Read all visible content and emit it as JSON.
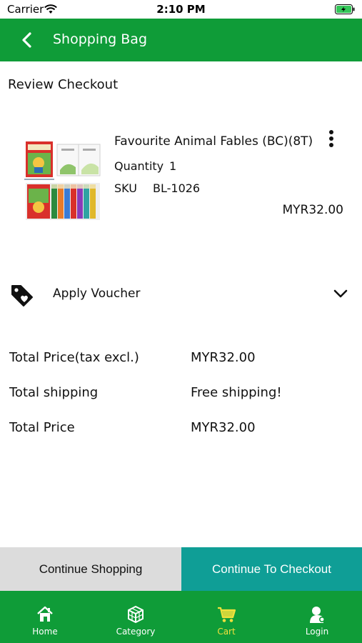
{
  "status_bar": {
    "carrier": "Carrier",
    "time": "2:10 PM"
  },
  "nav": {
    "title": "Shopping Bag"
  },
  "review": {
    "title": "Review Checkout"
  },
  "product": {
    "name": "Favourite Animal Fables (BC)(8T)",
    "quantity_label": "Quantity",
    "quantity_value": "1",
    "sku_label": "SKU",
    "sku_value": "BL-1026",
    "price": "MYR32.00"
  },
  "voucher": {
    "label": "Apply Voucher"
  },
  "totals": [
    {
      "label": "Total Price(tax excl.)",
      "value": "MYR32.00"
    },
    {
      "label": "Total shipping",
      "value": "Free shipping!"
    },
    {
      "label": "Total Price",
      "value": "MYR32.00"
    }
  ],
  "actions": {
    "continue_shopping": "Continue Shopping",
    "continue_checkout": "Continue To Checkout"
  },
  "tabs": [
    {
      "label": "Home",
      "icon": "home-icon"
    },
    {
      "label": "Category",
      "icon": "cube-icon"
    },
    {
      "label": "Cart",
      "icon": "cart-icon",
      "active": true
    },
    {
      "label": "Login",
      "icon": "user-icon"
    }
  ],
  "colors": {
    "primary_green": "#0f9c38",
    "checkout_teal": "#0f9e96",
    "active_tab": "#f0e03c",
    "continue_grey": "#dcdcdc"
  }
}
